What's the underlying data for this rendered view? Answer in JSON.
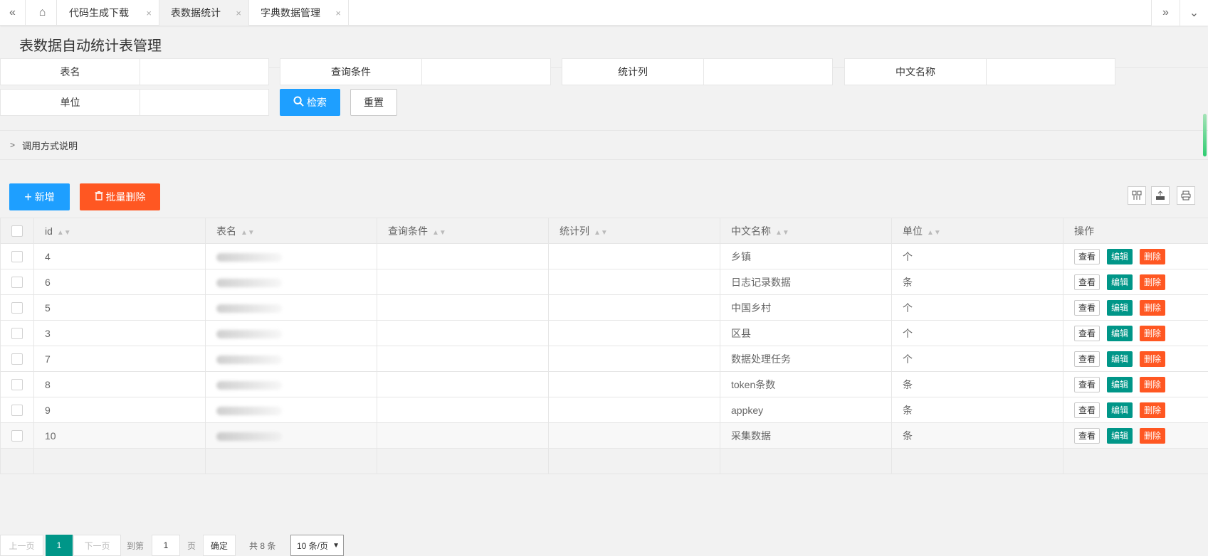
{
  "tabs": [
    {
      "label": "代码生成下载",
      "close": "×"
    },
    {
      "label": "表数据统计",
      "close": "×"
    },
    {
      "label": "字典数据管理",
      "close": "×"
    }
  ],
  "nav": {
    "back": "«",
    "home": "⌂",
    "forward": "»",
    "menu": "⌄"
  },
  "page": {
    "title": "表数据自动统计表管理"
  },
  "filters": {
    "table_name": "表名",
    "query_condition": "查询条件",
    "stat_column": "统计列",
    "cn_name": "中文名称",
    "unit": "单位"
  },
  "buttons": {
    "search": "检索",
    "reset": "重置",
    "add": "新增",
    "batch_delete": "批量删除"
  },
  "collapse": {
    "label": "调用方式说明"
  },
  "table": {
    "columns": [
      "id",
      "表名",
      "查询条件",
      "统计列",
      "中文名称",
      "单位",
      "操作"
    ],
    "rows": [
      {
        "id": "4",
        "name": "t_...",
        "query": "",
        "stat": "",
        "cn": "乡镇",
        "unit": "个"
      },
      {
        "id": "6",
        "name": "d_sys_log",
        "query": "",
        "stat": "",
        "cn": "日志记录数据",
        "unit": "条"
      },
      {
        "id": "5",
        "name": "c_china_village",
        "query": "",
        "stat": "",
        "cn": "中国乡村",
        "unit": "个"
      },
      {
        "id": "3",
        "name": "t_...",
        "query": "",
        "stat": "",
        "cn": "区县",
        "unit": "个"
      },
      {
        "id": "7",
        "name": "d_..._task",
        "query": "",
        "stat": "",
        "cn": "数据处理任务",
        "unit": "个"
      },
      {
        "id": "8",
        "name": "d_sys_token",
        "query": "",
        "stat": "",
        "cn": "token条数",
        "unit": "条"
      },
      {
        "id": "9",
        "name": "d_sys_appkey",
        "query": "",
        "stat": "",
        "cn": "appkey",
        "unit": "条"
      },
      {
        "id": "10",
        "name": "d_...",
        "query": "",
        "stat": "",
        "cn": "采集数据",
        "unit": "条"
      }
    ],
    "actions": {
      "view": "查看",
      "edit": "编辑",
      "delete": "删除"
    }
  },
  "pager": {
    "prev": "上一页",
    "current": "1",
    "next": "下一页",
    "goto": "到第",
    "page_input": "1",
    "page_unit": "页",
    "confirm": "确定",
    "total": "共 8 条",
    "page_size": "10 条/页"
  },
  "colors": {
    "primary": "#1e9fff",
    "danger": "#ff5722",
    "success": "#009688"
  }
}
